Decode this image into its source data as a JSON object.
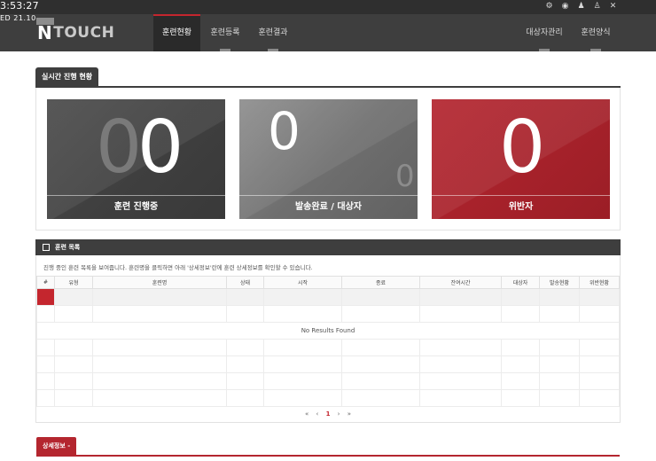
{
  "os": {
    "clock": "3:53:27",
    "clock_sub": "ED 21.10"
  },
  "header": {
    "logo_n": "N",
    "logo_rest": "TOUCH",
    "icons": [
      "gear-icon",
      "eye-icon",
      "user-add-icon",
      "user-icon",
      "close-icon"
    ],
    "nav_left": [
      "훈련현황",
      "훈련등록",
      "훈련결과"
    ],
    "nav_right": [
      "대상자관리",
      "훈련양식"
    ],
    "active": "훈련현황"
  },
  "realtime": {
    "title": "실시간 진행 현황",
    "cards": [
      {
        "big_ghost": "0",
        "big": "0",
        "label": "훈련 진행중"
      },
      {
        "big": "0",
        "small": "0",
        "label": "발송완료 / 대상자"
      },
      {
        "big": "0",
        "label": "위반자"
      }
    ]
  },
  "list": {
    "title": "훈련 목록",
    "description": "진행 중인 훈련 목록을 보여줍니다. 훈련명을 클릭하면 아래 '상세정보'란에 훈련 상세정보를 확인할 수 있습니다.",
    "columns": [
      "#",
      "유형",
      "훈련명",
      "상태",
      "시작",
      "종료",
      "잔여시간",
      "대상자",
      "발송현황",
      "위반현황"
    ],
    "empty_text": "No Results Found",
    "pager": {
      "first": "«",
      "prev": "‹",
      "current": "1",
      "next": "›",
      "last": "»"
    }
  },
  "detail": {
    "tab_label": "상세정보 -"
  },
  "colors": {
    "accent": "#c4262e",
    "dark": "#3e3e3e"
  }
}
